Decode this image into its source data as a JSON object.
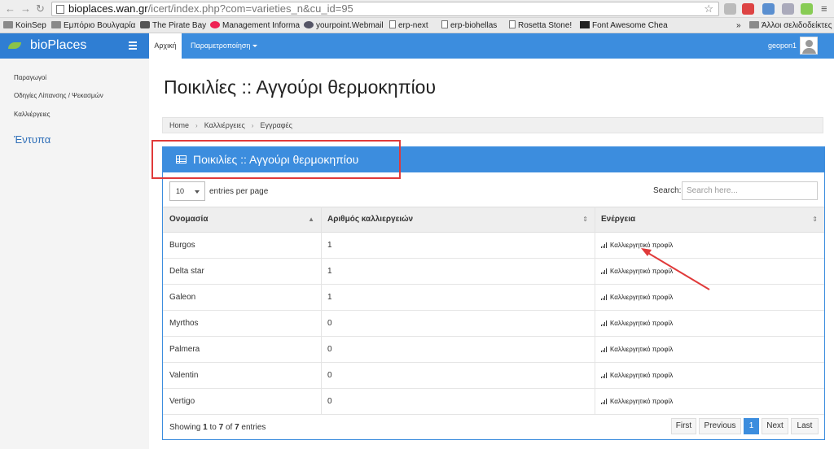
{
  "browser": {
    "url_host": "bioplaces.wan.gr",
    "url_path": "/icert/index.php?com=varieties_n&cu_id=95",
    "bookmarks": [
      {
        "label": "KoinSep",
        "icon": "folder-icon"
      },
      {
        "label": "Εμπόριο Βουλγαρία",
        "icon": "folder-icon"
      },
      {
        "label": "The Pirate Bay",
        "icon": "ship-icon"
      },
      {
        "label": "Management Informa",
        "icon": "apple-icon"
      },
      {
        "label": "yourpoint.Webmail",
        "icon": "webmail-icon"
      },
      {
        "label": "erp-next",
        "icon": "file-icon"
      },
      {
        "label": "erp-biohellas",
        "icon": "file-icon"
      },
      {
        "label": "Rosetta Stone!",
        "icon": "file-icon"
      },
      {
        "label": "Font Awesome Chea",
        "icon": "flag-icon"
      }
    ],
    "overflow": "»",
    "other_bookmarks": "Άλλοι σελιδοδείκτες"
  },
  "header": {
    "brand": "bioPlaces",
    "nav": {
      "home": "Αρχική",
      "settings": "Παραμετροποίηση"
    },
    "user": "geopon1"
  },
  "sidebar": {
    "items": [
      "Παραγωγοί",
      "Οδηγίες Λίπανσης / Ψεκασμών",
      "Καλλιέργειες"
    ],
    "heading": "Έντυπα"
  },
  "main": {
    "title": "Ποικιλίες :: Αγγούρι θερμοκηπίου",
    "breadcrumb": [
      "Home",
      "Καλλιέργειες",
      "Εγγραφές"
    ],
    "panel_title": "Ποικιλίες :: Αγγούρι θερμοκηπίου",
    "length": {
      "value": "10",
      "label": "entries per page"
    },
    "search": {
      "label": "Search:",
      "placeholder": "Search here..."
    },
    "columns": [
      "Ονομασία",
      "Αριθμός καλλιεργειών",
      "Ενέργεια"
    ],
    "rows": [
      {
        "name": "Burgos",
        "count": "1",
        "action": "Καλλιεργητικό προφίλ"
      },
      {
        "name": "Delta star",
        "count": "1",
        "action": "Καλλιεργητικό προφίλ"
      },
      {
        "name": "Galeon",
        "count": "1",
        "action": "Καλλιεργητικό προφίλ"
      },
      {
        "name": "Myrthos",
        "count": "0",
        "action": "Καλλιεργητικό προφίλ"
      },
      {
        "name": "Palmera",
        "count": "0",
        "action": "Καλλιεργητικό προφίλ"
      },
      {
        "name": "Valentin",
        "count": "0",
        "action": "Καλλιεργητικό προφίλ"
      },
      {
        "name": "Vertigo",
        "count": "0",
        "action": "Καλλιεργητικό προφίλ"
      }
    ],
    "info": {
      "prefix": "Showing",
      "from": "1",
      "to_word": "to",
      "to": "7",
      "of_word": "of",
      "total": "7",
      "suffix": "entries"
    },
    "pagination": {
      "first": "First",
      "previous": "Previous",
      "current": "1",
      "next": "Next",
      "last": "Last"
    }
  },
  "colors": {
    "primary": "#3c8dde",
    "annotation": "#e03a3a"
  }
}
